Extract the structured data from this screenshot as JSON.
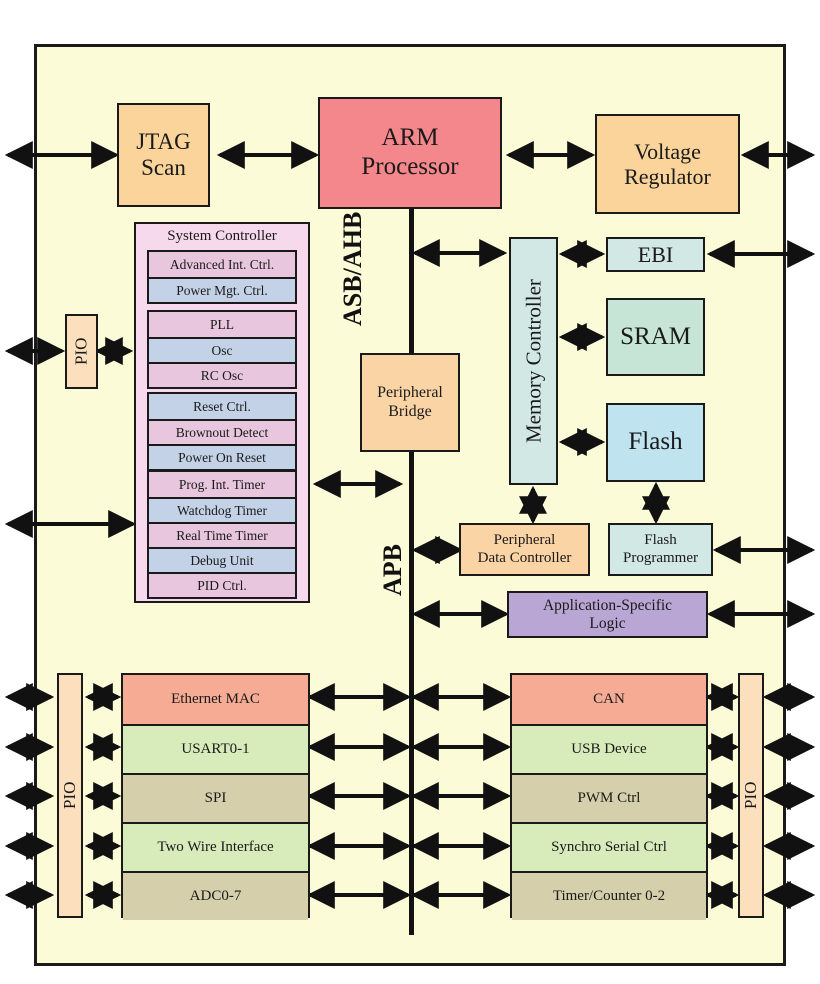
{
  "diagram": {
    "title": "ARM microcontroller block diagram",
    "chip_fill": "#fbfbd8",
    "bus_labels": {
      "ahb": "ASB/\nAHB",
      "apb": "APB"
    }
  },
  "top_blocks": {
    "jtag": {
      "label": "JTAG\nScan",
      "line1": "JTAG",
      "line2": "Scan",
      "color": "#fad49a"
    },
    "arm": {
      "label": "ARM\nProcessor",
      "line1": "ARM",
      "line2": "Processor",
      "color": "#f4878b"
    },
    "vreg": {
      "label": "Voltage\nRegulator",
      "line1": "Voltage",
      "line2": "Regulator",
      "color": "#fad49a"
    }
  },
  "pio": {
    "left_label": "PIO",
    "mid_label": "PIO",
    "right_label": "PIO",
    "color": "#fce0bd"
  },
  "system_controller": {
    "title": "System Controller",
    "container_color": "#f7d9ee",
    "groups": [
      {
        "name": "interrupt-power",
        "rows": [
          {
            "label": "Advanced Int. Ctrl.",
            "color": "#e7c6de"
          },
          {
            "label": "Power Mgt. Ctrl.",
            "color": "#c3d2e6"
          }
        ]
      },
      {
        "name": "clocks",
        "rows": [
          {
            "label": "PLL",
            "color": "#e7c6de"
          },
          {
            "label": "Osc",
            "color": "#c3d2e6"
          },
          {
            "label": "RC Osc",
            "color": "#e7c6de"
          }
        ]
      },
      {
        "name": "reset",
        "rows": [
          {
            "label": "Reset Ctrl.",
            "color": "#c3d2e6"
          },
          {
            "label": "Brownout Detect",
            "color": "#e7c6de"
          },
          {
            "label": "Power On Reset",
            "color": "#c3d2e6"
          }
        ]
      },
      {
        "name": "timers-debug",
        "rows": [
          {
            "label": "Prog. Int. Timer",
            "color": "#e7c6de"
          },
          {
            "label": "Watchdog Timer",
            "color": "#c3d2e6"
          },
          {
            "label": "Real Time Timer",
            "color": "#e7c6de"
          },
          {
            "label": "Debug Unit",
            "color": "#c3d2e6"
          },
          {
            "label": "PID Ctrl.",
            "color": "#e7c6de"
          }
        ]
      }
    ]
  },
  "bus_blocks": {
    "peripheral_bridge": {
      "line1": "Peripheral",
      "line2": "Bridge",
      "color": "#fad4a4"
    },
    "memory_controller": {
      "label": "Memory Controller",
      "color": "#d2e8e4"
    }
  },
  "memory": {
    "ebi": {
      "label": "EBI",
      "color": "#d2e8e4"
    },
    "sram": {
      "label": "SRAM",
      "color": "#c7e5d6"
    },
    "flash": {
      "label": "Flash",
      "color": "#bfe4f0"
    },
    "flash_programmer": {
      "line1": "Flash",
      "line2": "Programmer",
      "color": "#d2e8e4"
    }
  },
  "apb_blocks": {
    "pdc": {
      "line1": "Peripheral",
      "line2": "Data Controller",
      "color": "#fad4a4"
    },
    "asl": {
      "line1": "Application-Specific",
      "line2": "Logic",
      "color": "#b9a6d4"
    }
  },
  "peripherals_left": [
    {
      "label": "Ethernet MAC",
      "color": "#f6ab94"
    },
    {
      "label": "USART0-1",
      "color": "#d8ebbb"
    },
    {
      "label": "SPI",
      "color": "#d5cfac"
    },
    {
      "label": "Two Wire Interface",
      "color": "#d8ebbb"
    },
    {
      "label": "ADC0-7",
      "color": "#d5cfac"
    }
  ],
  "peripherals_right": [
    {
      "label": "CAN",
      "color": "#f6ab94"
    },
    {
      "label": "USB Device",
      "color": "#d8ebbb"
    },
    {
      "label": "PWM Ctrl",
      "color": "#d5cfac"
    },
    {
      "label": "Synchro Serial Ctrl",
      "color": "#d8ebbb"
    },
    {
      "label": "Timer/Counter 0-2",
      "color": "#d5cfac"
    }
  ]
}
